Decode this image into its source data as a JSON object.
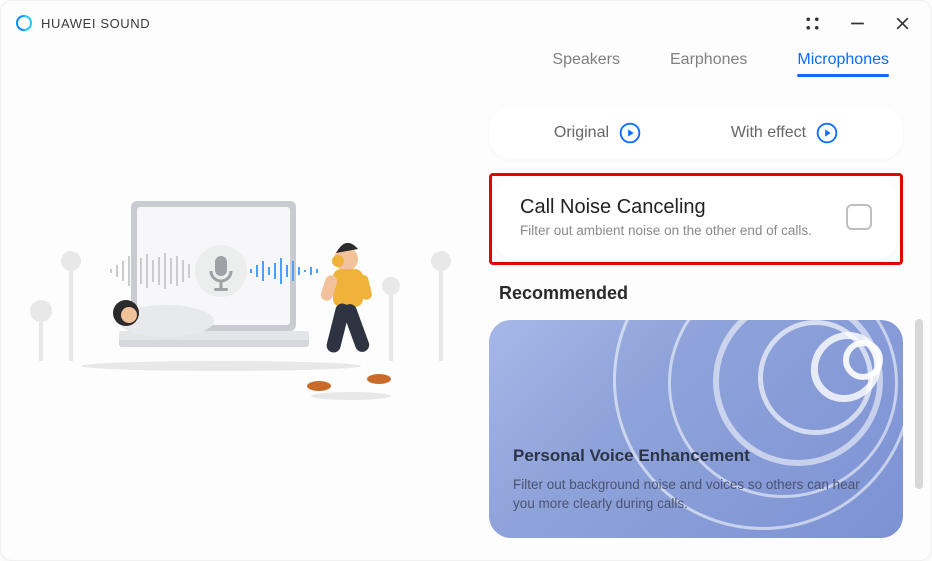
{
  "app": {
    "title": "HUAWEI SOUND"
  },
  "tabs": {
    "speakers": "Speakers",
    "earphones": "Earphones",
    "microphones": "Microphones",
    "active": "microphones"
  },
  "compare": {
    "original": "Original",
    "withEffect": "With effect"
  },
  "callNoise": {
    "title": "Call Noise Canceling",
    "desc": "Filter out ambient noise on the other end of calls.",
    "checked": false
  },
  "sectionHead": "Recommended",
  "promo": {
    "title": "Personal Voice Enhancement",
    "desc": "Filter out background noise and voices so others can hear you more clearly during calls."
  }
}
